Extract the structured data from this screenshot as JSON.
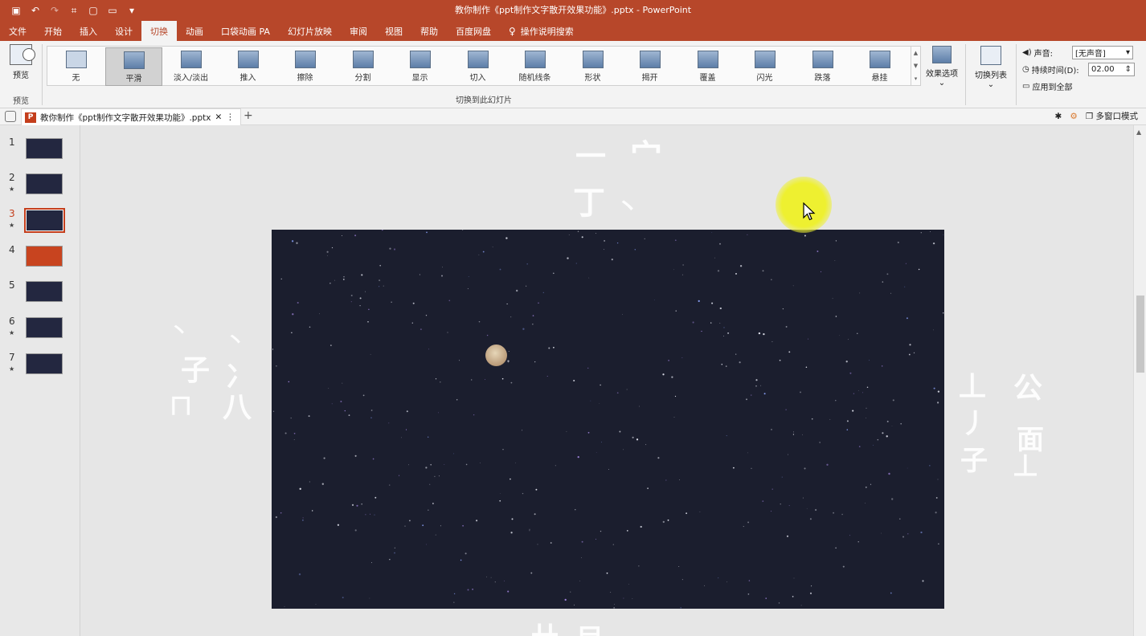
{
  "title_bar": {
    "title": "教你制作《ppt制作文字散开效果功能》.pptx  -  PowerPoint",
    "qat_icons": [
      "save-icon",
      "undo-icon",
      "redo-icon",
      "format-painter-icon",
      "new-file-icon",
      "open-folder-icon",
      "customize-qat-icon"
    ]
  },
  "ribbon_tabs": [
    "文件",
    "开始",
    "插入",
    "设计",
    "切换",
    "动画",
    "口袋动画 PA",
    "幻灯片放映",
    "审阅",
    "视图",
    "帮助",
    "百度网盘",
    "操作说明搜索"
  ],
  "active_tab": "切换",
  "preview_group": {
    "button": "预览",
    "label": "预览"
  },
  "transitions": {
    "group_label": "切换到此幻灯片",
    "items": [
      "无",
      "平滑",
      "淡入/淡出",
      "推入",
      "擦除",
      "分割",
      "显示",
      "切入",
      "随机线条",
      "形状",
      "揭开",
      "覆盖",
      "闪光",
      "跌落",
      "悬挂"
    ],
    "selected": "平滑"
  },
  "effect_options": "效果选项",
  "transition_list": "切换列表",
  "timing": {
    "sound_label": "声音:",
    "sound_value": "[无声音]",
    "duration_label": "持续时间(D):",
    "duration_value": "02.00",
    "apply_all": "应用到全部"
  },
  "doc_tab": {
    "name": "教你制作《ppt制作文字散开效果功能》.pptx",
    "badge": "P"
  },
  "doc_bar_right": {
    "multiwindow": "多窗口模式"
  },
  "slides": [
    {
      "num": "1",
      "star": "",
      "style": "dark"
    },
    {
      "num": "2",
      "star": "★",
      "style": "dark"
    },
    {
      "num": "3",
      "star": "★",
      "style": "dark",
      "current": true
    },
    {
      "num": "4",
      "star": "",
      "style": "orange"
    },
    {
      "num": "5",
      "star": "",
      "style": "dark"
    },
    {
      "num": "6",
      "star": "★",
      "style": "dark"
    },
    {
      "num": "7",
      "star": "★",
      "style": "dark"
    }
  ],
  "scattered_glyphs": {
    "top": [
      "一",
      "宀",
      "丁",
      "丶"
    ],
    "left": [
      "丶",
      "丶",
      "子",
      "冫",
      "八",
      "ㄇ"
    ],
    "right": [
      "丄",
      "公",
      "丿",
      "面",
      "子",
      "丄"
    ],
    "bottom": [
      "廾",
      "目"
    ]
  }
}
